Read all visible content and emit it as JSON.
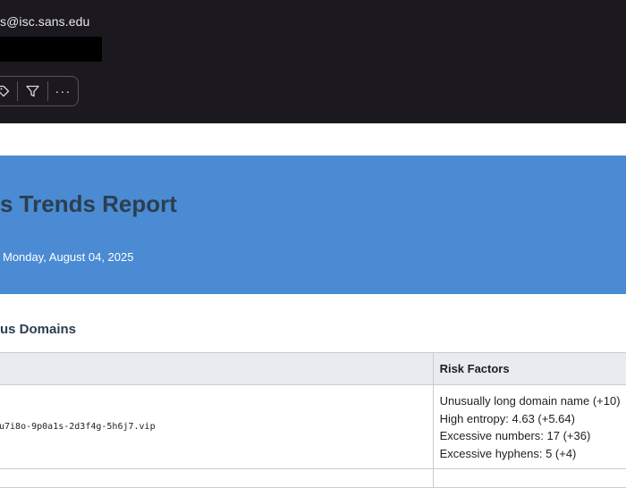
{
  "header": {
    "sender_email": "s@isc.sans.edu",
    "toolbar": {
      "tag_icon": "tag-icon",
      "filter_icon": "filter-icon",
      "more_label": "···"
    }
  },
  "colors": {
    "header_bg": "#1b191f",
    "banner_bg": "#4a8bd3",
    "title_text": "#2c3e50",
    "table_header_bg": "#e8ebef"
  },
  "report": {
    "title": "s Trends Report",
    "date": "Monday, August 04, 2025",
    "section_heading": "us Domains"
  },
  "table": {
    "headers": [
      "",
      "Risk Factors"
    ],
    "rows": [
      {
        "domain": "u7i8o-9p0a1s-2d3f4g-5h6j7.vip",
        "risk_factors": [
          "Unusually long domain name (+10)",
          "High entropy: 4.63 (+5.64)",
          "Excessive numbers: 17 (+36)",
          "Excessive hyphens: 5 (+4)"
        ]
      }
    ]
  }
}
